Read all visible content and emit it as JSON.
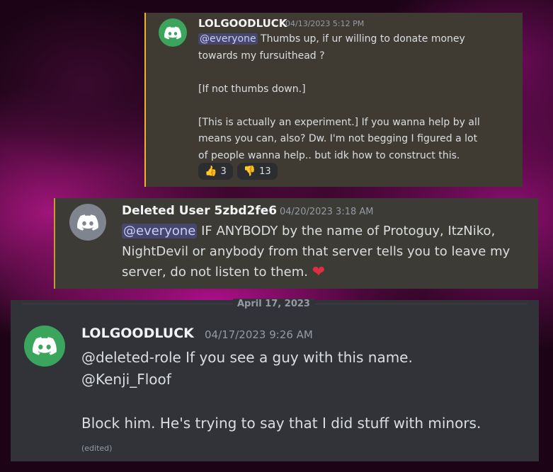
{
  "messages": [
    {
      "username": "LOLGOODLUCK",
      "timestamp": "04/13/2023 5:12 PM",
      "avatar_icon": "discord-icon",
      "avatar_color": "#3ba55d",
      "highlight_color": "#f0b232",
      "mention": "@everyone",
      "text": " Thumbs up, if ur willing to donate money towards my fursuithead ?\n\n[If not thumbs down.]\n\n[This is actually an experiment.] If you wanna help by all means you can, also? Dw. I'm not begging I figured a lot of people wanna help.. but idk how to construct this.",
      "reactions": [
        {
          "emoji_icon": "thumbs-up-emoji",
          "emoji": "👍",
          "count": "3"
        },
        {
          "emoji_icon": "thumbs-down-emoji",
          "emoji": "👎",
          "count": "13"
        }
      ]
    },
    {
      "username": "Deleted User 5zbd2fe6",
      "timestamp": "04/20/2023 3:18 AM",
      "avatar_icon": "discord-icon",
      "avatar_color": "#80848e",
      "mention": "@everyone",
      "text": " IF ANYBODY by the name of Protoguy, ItzNiko, NightDevil or anybody from that server tells you to leave my server, do not listen to them. ",
      "emoji_icon": "red-heart-emoji",
      "emoji": "❤"
    },
    {
      "date_divider": "April 17, 2023",
      "username": "LOLGOODLUCK",
      "timestamp": "04/17/2023 9:26 AM",
      "avatar_icon": "discord-icon",
      "avatar_color": "#3ba55d",
      "text": "@deleted-role If you see a guy with this name.\n@Kenji_Floof\n\nBlock him. He's trying to say that I did stuff with minors.",
      "edited": "(edited)"
    }
  ]
}
